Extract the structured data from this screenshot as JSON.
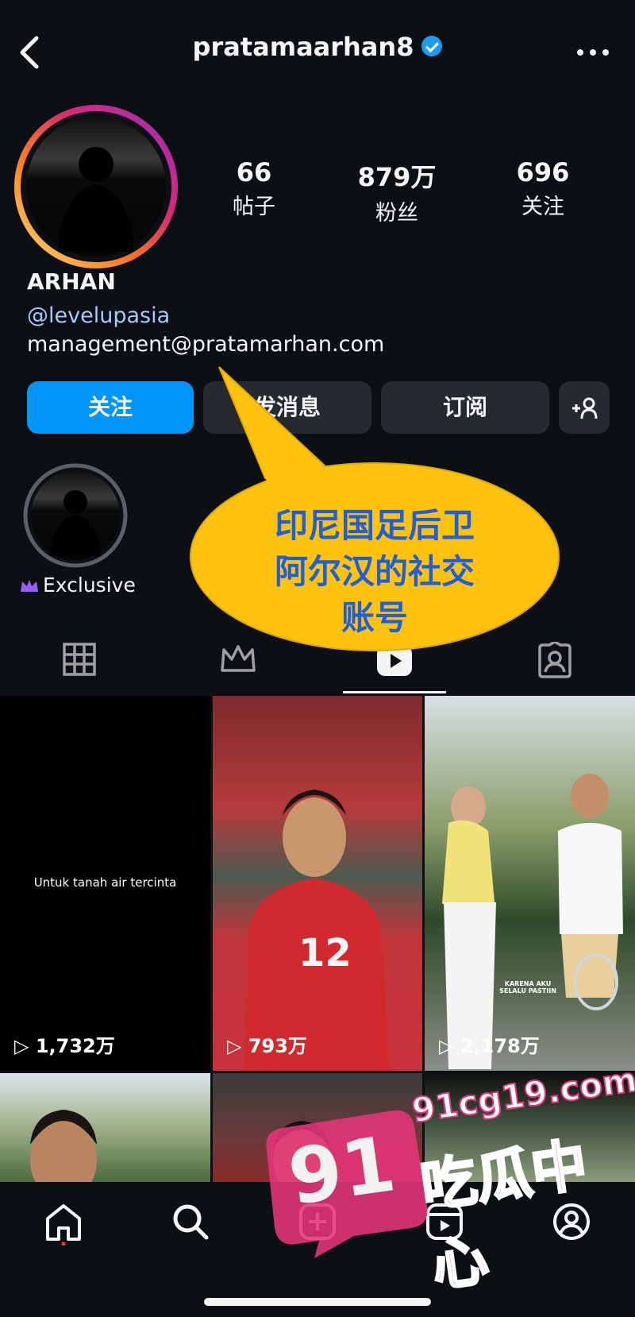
{
  "header": {
    "back_icon": "chevron-left-icon",
    "username": "pratamaarhan8",
    "more_icon": "more-horizontal-icon"
  },
  "stats": [
    {
      "value": "66",
      "label": "帖子"
    },
    {
      "value": "879万",
      "label": "粉丝"
    },
    {
      "value": "696",
      "label": "关注"
    }
  ],
  "profile": {
    "name": "ARHAN",
    "link": "@levelupasia",
    "email": "management@pratamarhan.com"
  },
  "buttons": {
    "follow": "关注",
    "message": "发消息",
    "subscribe": "订阅",
    "add_user_icon": "add-user-icon"
  },
  "highlight": {
    "label": "Exclusive"
  },
  "annotation": {
    "line1": "印尼国足后卫",
    "line2": "阿尔汉的社交",
    "line3": "账号"
  },
  "tabs": [
    "grid-icon",
    "crown-icon",
    "reels-icon",
    "tagged-icon"
  ],
  "posts": [
    {
      "overlay_text": "Untuk tanah air tercinta",
      "views": "1,732万"
    },
    {
      "views": "793万"
    },
    {
      "views": "2,178万",
      "caption": "KARENA AKU SELALU PASTIIN"
    }
  ],
  "watermark": {
    "url": "91cg19.com",
    "number": "91",
    "text": "吃瓜中心"
  },
  "colors": {
    "accent": "#0095f6",
    "verified": "#1d9bf0",
    "background": "#0c1014",
    "callout": "#ffc20e",
    "watermark": "#e6367a"
  }
}
